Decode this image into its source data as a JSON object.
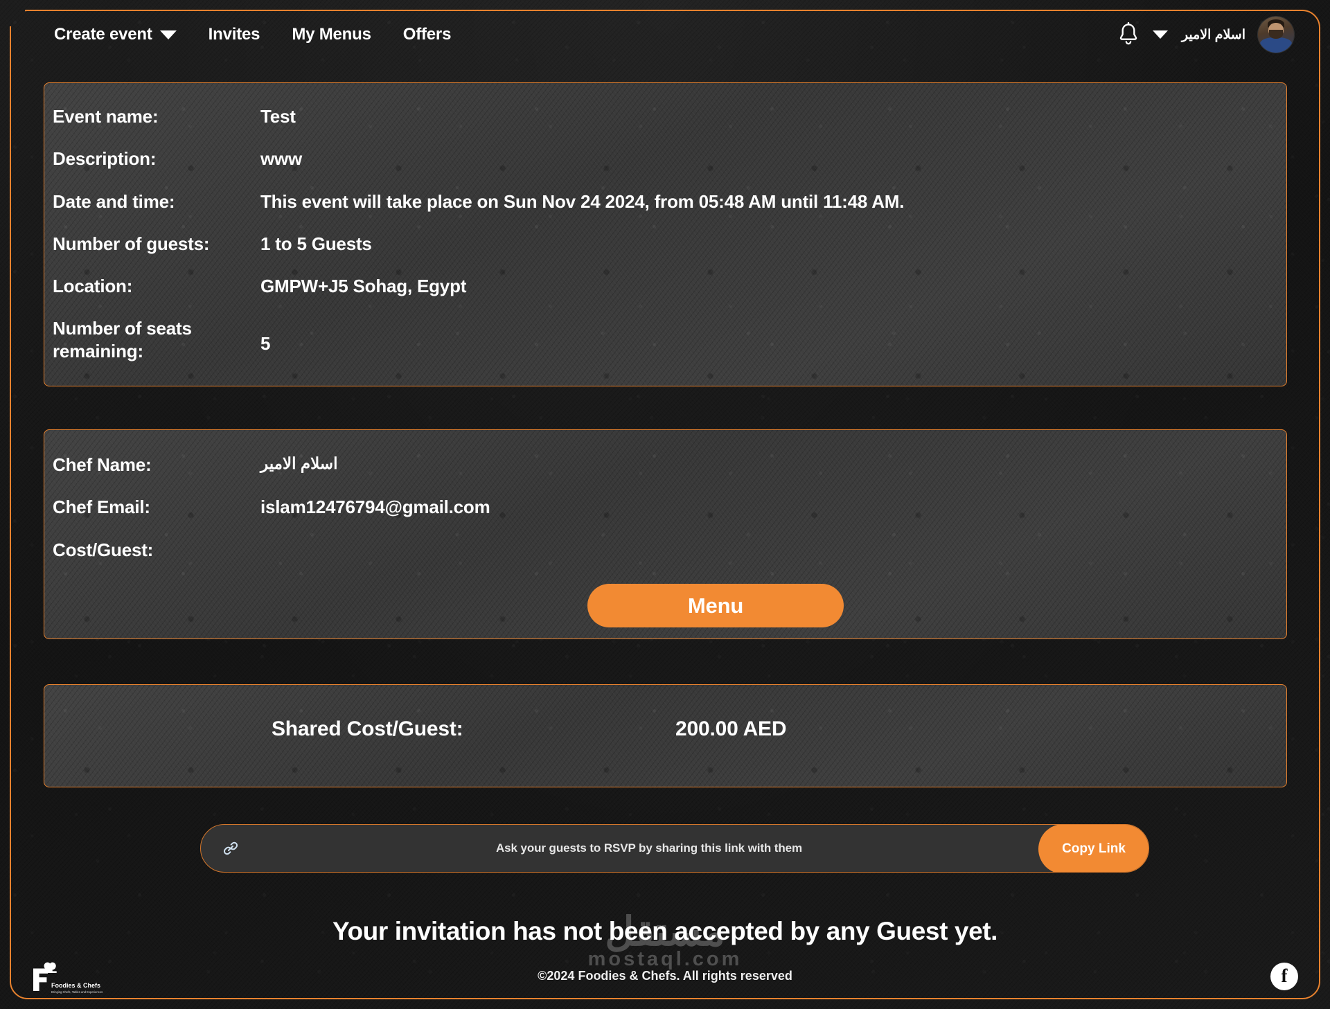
{
  "theme": {
    "accent": "#f28a33",
    "border_accent": "#e8822e",
    "page_bg": "#161616",
    "card_bg": "#3b3b3b",
    "text": "#ffffff"
  },
  "topnav": {
    "items": [
      {
        "label": "Create event",
        "has_caret": true
      },
      {
        "label": "Invites",
        "has_caret": false
      },
      {
        "label": "My Menus",
        "has_caret": false
      },
      {
        "label": "Offers",
        "has_caret": false
      }
    ],
    "notification_icon": "bell-icon",
    "account_caret": "chevron-down-icon",
    "user_name": "اسلام الامير",
    "avatar_alt": "user-avatar"
  },
  "event": {
    "rows": [
      {
        "label": "Event name:",
        "value": "Test"
      },
      {
        "label": "Description:",
        "value": "www"
      },
      {
        "label": "Date and time:",
        "value": "This event will take place on Sun Nov 24 2024, from 05:48 AM until 11:48 AM."
      },
      {
        "label": "Number of guests:",
        "value": "1 to 5 Guests"
      },
      {
        "label": "Location:",
        "value": "GMPW+J5 Sohag, Egypt"
      },
      {
        "label": "Number of seats remaining:",
        "value": "5"
      }
    ]
  },
  "chef": {
    "name_label": "Chef Name:",
    "name_value": "اسلام الامير",
    "email_label": "Chef Email:",
    "email_value": "islam12476794@gmail.com",
    "cost_label": "Cost/Guest:",
    "cost_value": "",
    "menu_button": "Menu"
  },
  "shared_cost": {
    "label": "Shared Cost/Guest:",
    "value": "200.00 AED"
  },
  "share_link": {
    "icon": "link-icon",
    "text": "Ask your guests to RSVP by sharing this link with them",
    "button_label": "Copy Link"
  },
  "footer": {
    "invite_status": "Your invitation has not been accepted by any Guest yet.",
    "watermark_ar": "مستقل",
    "watermark_en": "mostaql.com",
    "copyright": "©2024 Foodies & Chefs. All rights reserved",
    "brand_name": "Foodies & Chefs",
    "brand_tagline": "Bringing Chefs, Tables and Experiences",
    "social_icon": "facebook-icon",
    "social_glyph": "f"
  }
}
